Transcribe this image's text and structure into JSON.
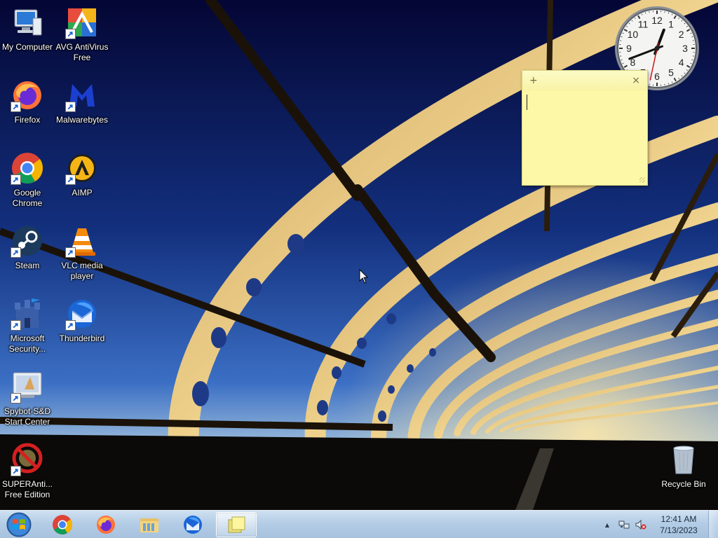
{
  "desktop": {
    "icons": [
      {
        "label": "My Computer",
        "icon": "computer-icon"
      },
      {
        "label": "AVG AntiVirus Free",
        "icon": "avg-icon"
      },
      {
        "label": "Firefox",
        "icon": "firefox-icon"
      },
      {
        "label": "Malwarebytes",
        "icon": "malwarebytes-icon"
      },
      {
        "label": "Google Chrome",
        "icon": "chrome-icon"
      },
      {
        "label": "AIMP",
        "icon": "aimp-icon"
      },
      {
        "label": "Steam",
        "icon": "steam-icon"
      },
      {
        "label": "VLC media player",
        "icon": "vlc-icon"
      },
      {
        "label": "Microsoft Security...",
        "icon": "microsoft-security-icon"
      },
      {
        "label": "Thunderbird",
        "icon": "thunderbird-icon"
      },
      {
        "label": "Spybot-S&D Start Center",
        "icon": "spybot-icon"
      },
      {
        "label": "SUPERAnti... Free Edition",
        "icon": "superantispyware-icon"
      },
      {
        "label": "Recycle Bin",
        "icon": "recycle-bin-icon"
      }
    ]
  },
  "clock_gadget": {
    "numerals": [
      "12",
      "1",
      "2",
      "3",
      "4",
      "5",
      "6",
      "7",
      "8",
      "9",
      "10",
      "11"
    ],
    "hour": 12,
    "minute": 41,
    "second": 32
  },
  "sticky_note": {
    "add_glyph": "+",
    "close_glyph": "×",
    "text": "",
    "color": "#fdf8a8"
  },
  "taskbar": {
    "start_icon": "windows-logo-icon",
    "pinned": [
      {
        "name": "chrome-icon",
        "active": false
      },
      {
        "name": "firefox-icon",
        "active": false
      },
      {
        "name": "file-explorer-icon",
        "active": false
      },
      {
        "name": "thunderbird-icon",
        "active": false
      },
      {
        "name": "sticky-notes-icon",
        "active": true
      }
    ],
    "tray": {
      "show_hidden_glyph": "▲",
      "time": "12:41 AM",
      "date": "7/13/2023"
    }
  },
  "colors": {
    "sky_top": "#050a3a",
    "sky_bottom": "#2a5fb8",
    "bridge": "#f3d48a",
    "taskbar": "#b4cde6"
  }
}
